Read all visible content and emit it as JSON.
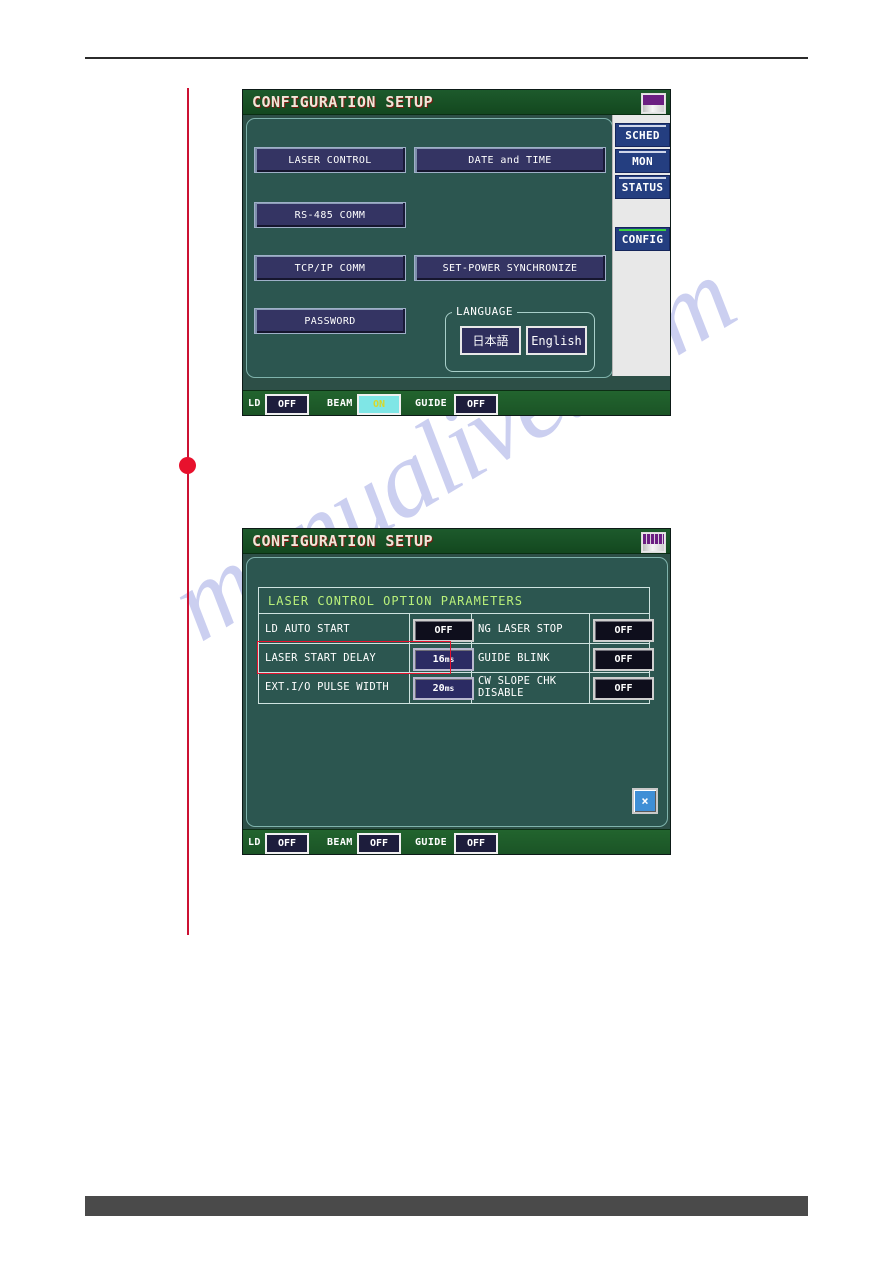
{
  "watermark": {
    "text": "manualive.com"
  },
  "screens": [
    {
      "id": "configuration-setup-main",
      "title": "CONFIGURATION SETUP",
      "title_icon": "lamp-indicator-icon",
      "menu_buttons": [
        {
          "label": "LASER CONTROL"
        },
        {
          "label": "DATE and TIME"
        },
        {
          "label": "RS-485 COMM"
        },
        {
          "label": "TCP/IP COMM"
        },
        {
          "label": "SET-POWER SYNCHRONIZE"
        },
        {
          "label": "PASSWORD"
        }
      ],
      "language_group": {
        "legend": "LANGUAGE",
        "options": [
          {
            "label": "日本語"
          },
          {
            "label": "English"
          }
        ]
      },
      "tabs": [
        {
          "label": "SCHED",
          "active": false
        },
        {
          "label": "MON",
          "active": false
        },
        {
          "label": "STATUS",
          "active": false
        },
        {
          "label": "CONFIG",
          "active": true
        }
      ],
      "statusbar": [
        {
          "label": "LD",
          "value": "OFF",
          "state": "off"
        },
        {
          "label": "BEAM",
          "value": "ON",
          "state": "on"
        },
        {
          "label": "GUIDE",
          "value": "OFF",
          "state": "off"
        }
      ]
    },
    {
      "id": "configuration-setup-laser-options",
      "title": "CONFIGURATION SETUP",
      "title_icon": "lamp-indicator-striped-icon",
      "table": {
        "heading": "LASER CONTROL OPTION PARAMETERS",
        "rows": [
          {
            "left_label": "LD AUTO START",
            "left_value": "OFF",
            "left_numeric": false,
            "left_unit": "",
            "right_label": "NG LASER STOP",
            "right_value": "OFF"
          },
          {
            "left_label": "LASER START DELAY",
            "left_value": "16",
            "left_numeric": true,
            "left_unit": "ms",
            "right_label": "GUIDE BLINK",
            "right_value": "OFF"
          },
          {
            "left_label": "EXT.I/O PULSE WIDTH",
            "left_value": "20",
            "left_numeric": true,
            "left_unit": "ms",
            "right_label": "CW SLOPE CHK DISABLE",
            "right_value": "OFF"
          }
        ]
      },
      "close_button": {
        "label": "×"
      },
      "statusbar": [
        {
          "label": "LD",
          "value": "OFF",
          "state": "off"
        },
        {
          "label": "BEAM",
          "value": "OFF",
          "state": "off"
        },
        {
          "label": "GUIDE",
          "value": "OFF",
          "state": "off"
        }
      ]
    }
  ],
  "colors": {
    "screen_bg": "#2c5650",
    "title_green": "#1d5a2c",
    "button_navy": "#343463",
    "tab_blue": "#243e80",
    "active_tab_marker": "#39d23f",
    "heading_yellow_green": "#b9f07a",
    "callout_red": "#e8112d",
    "watermark": "#c9cdf0"
  }
}
